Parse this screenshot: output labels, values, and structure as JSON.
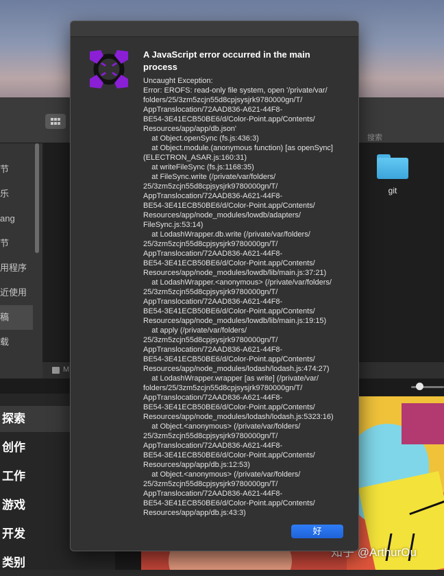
{
  "finder": {
    "search_label": "搜索",
    "sidebar_items": [
      {
        "label": "节"
      },
      {
        "label": "乐"
      },
      {
        "label": "ang"
      },
      {
        "label": "节"
      },
      {
        "label": "用程序"
      },
      {
        "label": "近使用"
      },
      {
        "label": "稿"
      },
      {
        "label": "载"
      }
    ],
    "folder_name": "git",
    "status_text": "M"
  },
  "app_nav": {
    "items": [
      {
        "label": "探索"
      },
      {
        "label": "创作"
      },
      {
        "label": "工作"
      },
      {
        "label": "游戏"
      },
      {
        "label": "开发"
      },
      {
        "label": "类别"
      }
    ]
  },
  "dialog": {
    "title": "A JavaScript error occurred in the main process",
    "message": "Uncaught Exception:\nError: EROFS: read-only file system, open '/private/var/\nfolders/25/3zm5zcjn55d8cpjsysjrk9780000gn/T/\nAppTranslocation/72AAD836-A621-44F8-\nBE54-3E41ECB50BE6/d/Color-Point.app/Contents/\nResources/app/app/db.json'\n    at Object.openSync (fs.js:436:3)\n    at Object.module.(anonymous function) [as openSync]\n(ELECTRON_ASAR.js:160:31)\n    at writeFileSync (fs.js:1168:35)\n    at FileSync.write (/private/var/folders/\n25/3zm5zcjn55d8cpjsysjrk9780000gn/T/\nAppTranslocation/72AAD836-A621-44F8-\nBE54-3E41ECB50BE6/d/Color-Point.app/Contents/\nResources/app/node_modules/lowdb/adapters/\nFileSync.js:53:14)\n    at LodashWrapper.db.write (/private/var/folders/\n25/3zm5zcjn55d8cpjsysjrk9780000gn/T/\nAppTranslocation/72AAD836-A621-44F8-\nBE54-3E41ECB50BE6/d/Color-Point.app/Contents/\nResources/app/node_modules/lowdb/lib/main.js:37:21)\n    at LodashWrapper.<anonymous> (/private/var/folders/\n25/3zm5zcjn55d8cpjsysjrk9780000gn/T/\nAppTranslocation/72AAD836-A621-44F8-\nBE54-3E41ECB50BE6/d/Color-Point.app/Contents/\nResources/app/node_modules/lowdb/lib/main.js:19:15)\n    at apply (/private/var/folders/\n25/3zm5zcjn55d8cpjsysjrk9780000gn/T/\nAppTranslocation/72AAD836-A621-44F8-\nBE54-3E41ECB50BE6/d/Color-Point.app/Contents/\nResources/app/node_modules/lodash/lodash.js:474:27)\n    at LodashWrapper.wrapper [as write] (/private/var/\nfolders/25/3zm5zcjn55d8cpjsysjrk9780000gn/T/\nAppTranslocation/72AAD836-A621-44F8-\nBE54-3E41ECB50BE6/d/Color-Point.app/Contents/\nResources/app/node_modules/lodash/lodash.js:5323:16)\n    at Object.<anonymous> (/private/var/folders/\n25/3zm5zcjn55d8cpjsysjrk9780000gn/T/\nAppTranslocation/72AAD836-A621-44F8-\nBE54-3E41ECB50BE6/d/Color-Point.app/Contents/\nResources/app/app/db.js:12:53)\n    at Object.<anonymous> (/private/var/folders/\n25/3zm5zcjn55d8cpjsysjrk9780000gn/T/\nAppTranslocation/72AAD836-A621-44F8-\nBE54-3E41ECB50BE6/d/Color-Point.app/Contents/\nResources/app/app/db.js:43:3)",
    "ok_label": "好",
    "icon": "color-point-app-icon",
    "accent_color": "#8a1fd6",
    "button_color": "#2f7df7"
  },
  "watermark": "知乎 @ArthurOu"
}
